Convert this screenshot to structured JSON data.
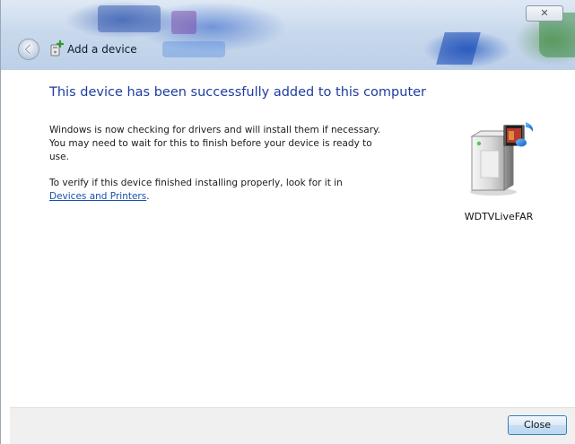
{
  "window": {
    "title": "Add a device",
    "close_glyph": "✕"
  },
  "content": {
    "heading": "This device has been successfully added to this computer",
    "paragraph1": "Windows is now checking for drivers and will install them if necessary. You may need to wait for this to finish before your device is ready to use.",
    "paragraph2_prefix": "To verify if this device finished installing properly, look for it in",
    "paragraph2_link": "Devices and Printers",
    "paragraph2_suffix": "."
  },
  "device": {
    "name": "WDTVLiveFAR",
    "icon": "media-device-icon"
  },
  "footer": {
    "close_label": "Close"
  }
}
